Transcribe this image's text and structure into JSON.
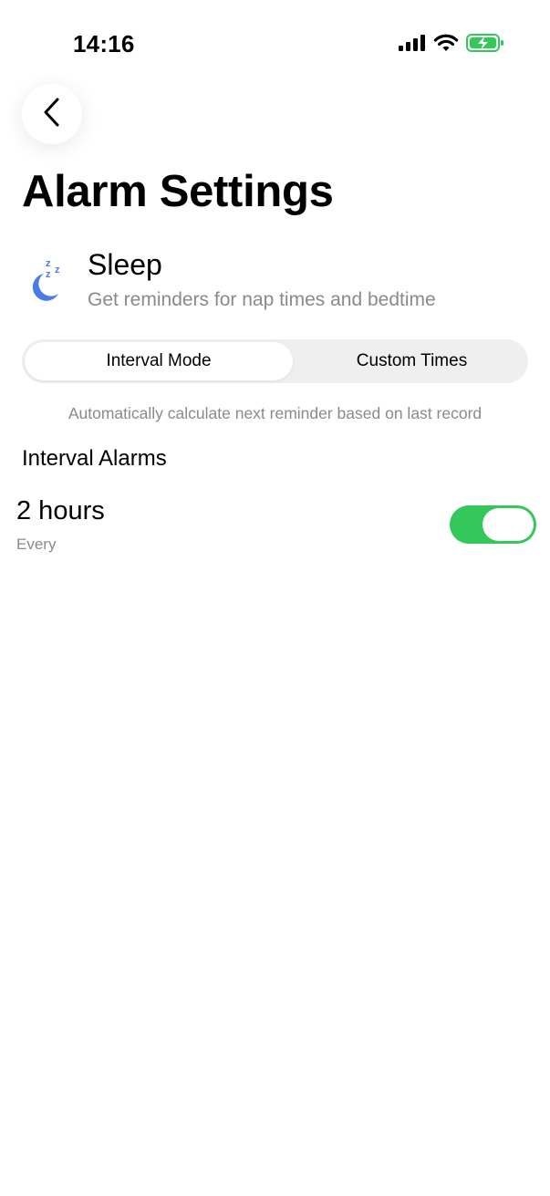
{
  "status_bar": {
    "time": "14:16",
    "icons": [
      "cellular-signal-icon",
      "wifi-icon",
      "battery-charging-icon"
    ],
    "battery_color": "#34c759"
  },
  "header": {
    "back_icon": "chevron-left-icon",
    "title": "Alarm Settings"
  },
  "category": {
    "icon": "sleep-moon-zzz-icon",
    "icon_color": "#4a7be8",
    "name": "Sleep",
    "description": "Get reminders for nap times and bedtime"
  },
  "mode_selector": {
    "options": [
      {
        "label": "Interval Mode",
        "selected": true
      },
      {
        "label": "Custom Times",
        "selected": false
      }
    ]
  },
  "hint": "Automatically calculate next reminder based on last record",
  "interval_alarms": {
    "section_title": "Interval Alarms",
    "items": [
      {
        "value": "2 hours",
        "caption": "Every",
        "enabled": true
      }
    ]
  },
  "colors": {
    "toggle_on": "#34c759",
    "secondary_text": "#8a8a8a",
    "segmented_bg": "#efefef"
  }
}
